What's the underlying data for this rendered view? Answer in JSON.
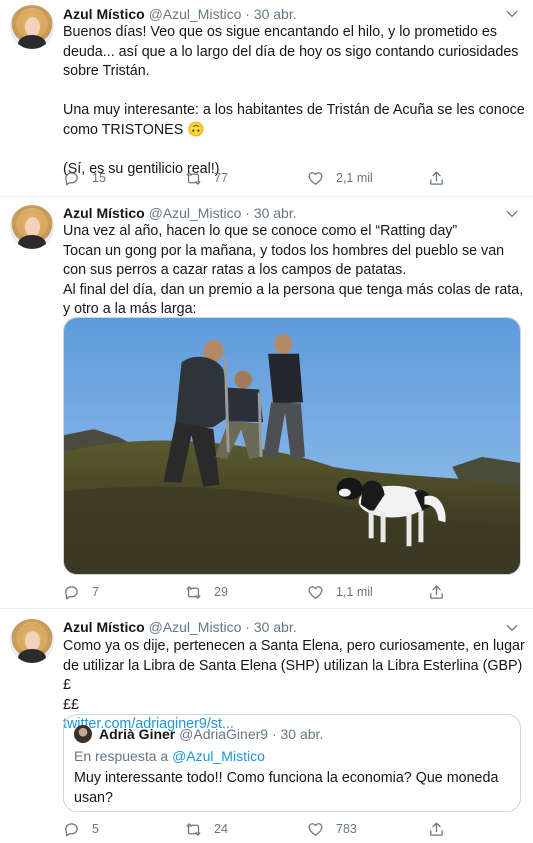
{
  "tweets": [
    {
      "author": {
        "name": "Azul Místico",
        "handle": "@Azul_Mistico",
        "date": "30 abr."
      },
      "text_lines": [
        "Buenos días! Veo que os sigue encantando el hilo, y lo prometido es",
        "deuda... así que a lo largo del día de hoy os sigo contando curiosidades",
        "sobre Tristán.",
        "",
        "Una muy interesante: a los habitantes de Tristán de Acuña se les conoce",
        "como TRISTONES 🙃",
        "",
        "(Sí, es su gentilicio real!)"
      ],
      "actions": {
        "replies": "15",
        "retweets": "77",
        "likes": "2,1 mil"
      }
    },
    {
      "author": {
        "name": "Azul Místico",
        "handle": "@Azul_Mistico",
        "date": "30 abr."
      },
      "text_lines": [
        "Una vez al año, hacen lo que se conoce como el “Ratting day”",
        "Tocan un gong por la mañana, y todos los hombres del pueblo se van",
        "con sus perros a cazar ratas a los campos de patatas.",
        "Al final del día, dan un premio a la persona que tenga más colas de rata,",
        "y otro a la más larga:"
      ],
      "actions": {
        "replies": "7",
        "retweets": "29",
        "likes": "1,1 mil"
      }
    },
    {
      "author": {
        "name": "Azul Místico",
        "handle": "@Azul_Mistico",
        "date": "30 abr."
      },
      "text_lines": [
        "Como ya os dije, pertenecen a Santa Elena, pero curiosamente, en lugar",
        "de utilizar la Libra de Santa Elena (SHP) utilizan la Libra Esterlina (GBP) £",
        "££"
      ],
      "link": "twitter.com/adriaginer9/st...",
      "quote": {
        "name": "Adrià Giner",
        "handle": "@AdriaGiner9",
        "date": "30 abr.",
        "reply_prefix": "En respuesta a",
        "reply_to": "@Azul_Mistico",
        "text_lines": [
          "Muy interessante todo!! Como funciona la economia? Que moneda",
          "usan?"
        ]
      },
      "actions": {
        "replies": "5",
        "retweets": "24",
        "likes": "783"
      }
    }
  ],
  "sep": " · ",
  "icons": {
    "reply": "reply-icon",
    "retweet": "retweet-icon",
    "like": "heart-icon",
    "share": "share-icon",
    "caret": "chevron-down-icon"
  },
  "colors": {
    "text": "#14171a",
    "secondary": "#657786",
    "link": "#1b95e0",
    "border": "#e6ecf0"
  }
}
